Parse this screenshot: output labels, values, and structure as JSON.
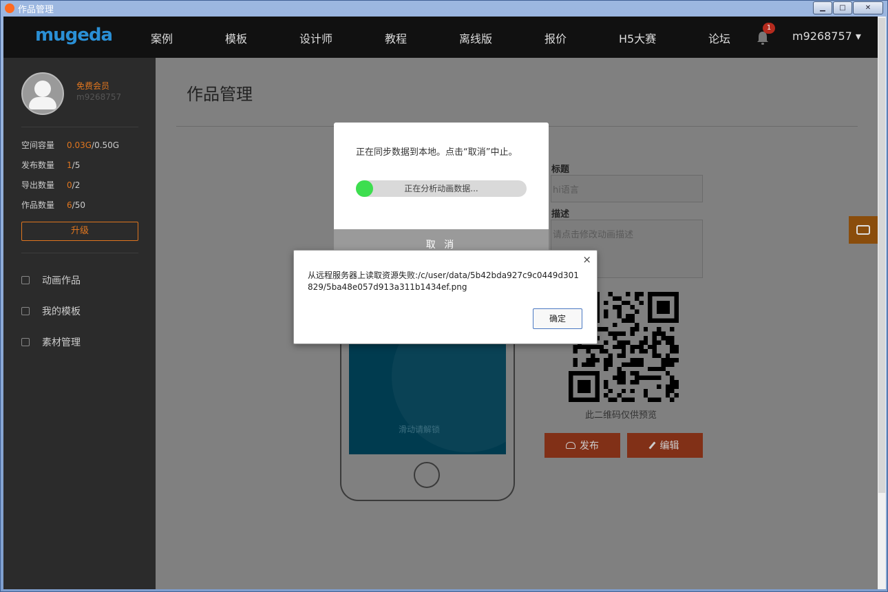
{
  "window": {
    "title": "作品管理",
    "minimize": "▁",
    "maximize": "□",
    "close": "✕"
  },
  "nav": {
    "logo": "mugeda",
    "items": [
      "案例",
      "模板",
      "设计师",
      "教程",
      "离线版",
      "报价",
      "H5大赛",
      "论坛"
    ],
    "notif_count": "1",
    "username": "m9268757 ▾"
  },
  "sidebar": {
    "member_type": "免费会员",
    "user_id": "m9268757",
    "stats": [
      {
        "label": "空间容量",
        "used": "0.03G",
        "total": "/0.50G"
      },
      {
        "label": "发布数量",
        "used": "1",
        "total": "/5"
      },
      {
        "label": "导出数量",
        "used": "0",
        "total": "/2"
      },
      {
        "label": "作品数量",
        "used": "6",
        "total": "/50"
      }
    ],
    "upgrade": "升级",
    "links": [
      "动画作品",
      "我的模板",
      "素材管理"
    ]
  },
  "main": {
    "title": "作品管理",
    "unlock_text": "滑动请解锁",
    "title_label": "标题",
    "title_value": "hi语言",
    "desc_label": "描述",
    "desc_placeholder": "请点击修改动画描述",
    "qr_caption": "此二维码仅供预览",
    "publish": "发布",
    "edit": "编辑"
  },
  "sync_dialog": {
    "message": "正在同步数据到本地。点击“取消”中止。",
    "progress_text": "正在分析动画数据...",
    "progress": 0.1,
    "cancel": "取 消"
  },
  "alert_dialog": {
    "close": "×",
    "message": "从远程服务器上读取资源失败:/c/user/data/5b42bda927c9c0449d301829/5ba48e057d913a311b1434ef.png",
    "ok": "确定"
  }
}
